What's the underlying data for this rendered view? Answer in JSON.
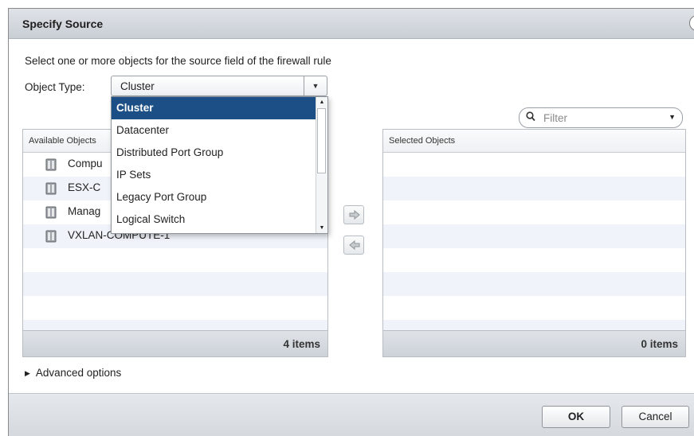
{
  "dialog": {
    "title": "Specify Source",
    "help_label": "?",
    "instruction": "Select one or more objects for the source field of the firewall rule",
    "object_type_label": "Object Type:",
    "object_type_value": "Cluster",
    "filter_placeholder": "Filter"
  },
  "available": {
    "header": "Available Objects",
    "items": [
      {
        "label": "Compu"
      },
      {
        "label": "ESX-C"
      },
      {
        "label": "Manag"
      },
      {
        "label": "VXLAN-COMPUTE-1"
      }
    ],
    "count": "4 items"
  },
  "selected": {
    "header": "Selected Objects",
    "count": "0 items"
  },
  "dropdown": {
    "options": [
      {
        "label": "Cluster",
        "selected": true
      },
      {
        "label": "Datacenter",
        "selected": false
      },
      {
        "label": "Distributed Port Group",
        "selected": false
      },
      {
        "label": "IP Sets",
        "selected": false
      },
      {
        "label": "Legacy Port Group",
        "selected": false
      },
      {
        "label": "Logical Switch",
        "selected": false
      }
    ]
  },
  "advanced_label": "Advanced options",
  "buttons": {
    "ok": "OK",
    "cancel": "Cancel"
  },
  "colors": {
    "selection": "#1c4f86",
    "row_alt": "#f0f4fa"
  }
}
